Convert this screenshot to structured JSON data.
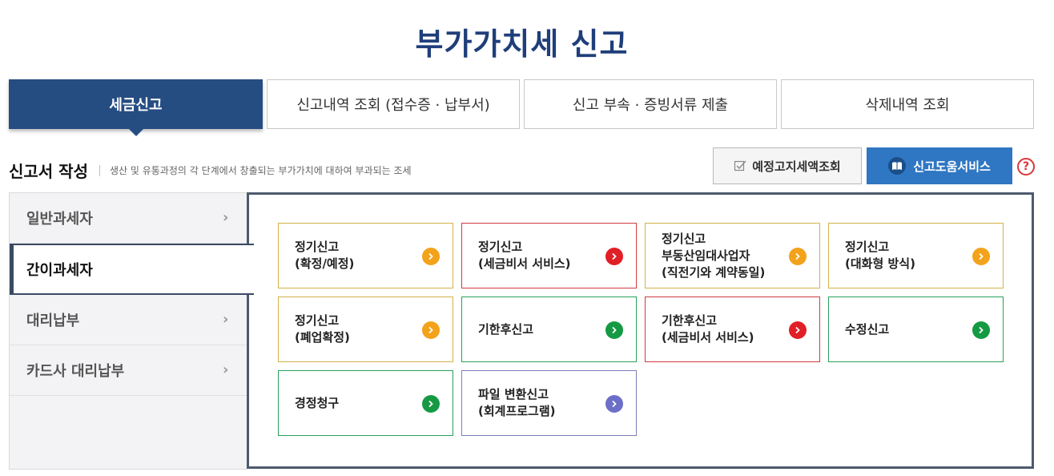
{
  "page": {
    "title": "부가가치세 신고"
  },
  "tabs": [
    {
      "label": "세금신고",
      "active": true
    },
    {
      "label": "신고내역 조회 (접수증 · 납부서)",
      "active": false
    },
    {
      "label": "신고 부속 · 증빙서류 제출",
      "active": false
    },
    {
      "label": "삭제내역 조회",
      "active": false
    }
  ],
  "section": {
    "title": "신고서 작성",
    "description": "생산 및 유통과정의 각 단계에서 창출되는 부가가치에 대하여 부과되는 조세"
  },
  "buttons": {
    "lookup_label": "예정고지세액조회",
    "help_label": "신고도움서비스",
    "help_question": "?"
  },
  "sidebar": {
    "items": [
      {
        "label": "일반과세자",
        "active": false
      },
      {
        "label": "간이과세자",
        "active": true
      },
      {
        "label": "대리납부",
        "active": false
      },
      {
        "label": "카드사 대리납부",
        "active": false
      }
    ]
  },
  "cards": [
    {
      "label": "정기신고\n(확정/예정)",
      "color": "#f3a21b"
    },
    {
      "label": "정기신고\n(세금비서 서비스)",
      "color": "#e01f26"
    },
    {
      "label": "정기신고\n부동산임대사업자\n(직전기와 계약동일)",
      "color": "#f3a21b"
    },
    {
      "label": "정기신고\n(대화형 방식)",
      "color": "#f3a21b"
    },
    {
      "label": "정기신고\n(폐업확정)",
      "color": "#f3a21b"
    },
    {
      "label": "기한후신고",
      "color": "#159a43"
    },
    {
      "label": "기한후신고\n(세금비서 서비스)",
      "color": "#e01f26"
    },
    {
      "label": "수정신고",
      "color": "#159a43"
    },
    {
      "label": "경정청구",
      "color": "#159a43"
    },
    {
      "label": "파일 변환신고\n(회계프로그램)",
      "color": "#6c6fc8"
    }
  ]
}
